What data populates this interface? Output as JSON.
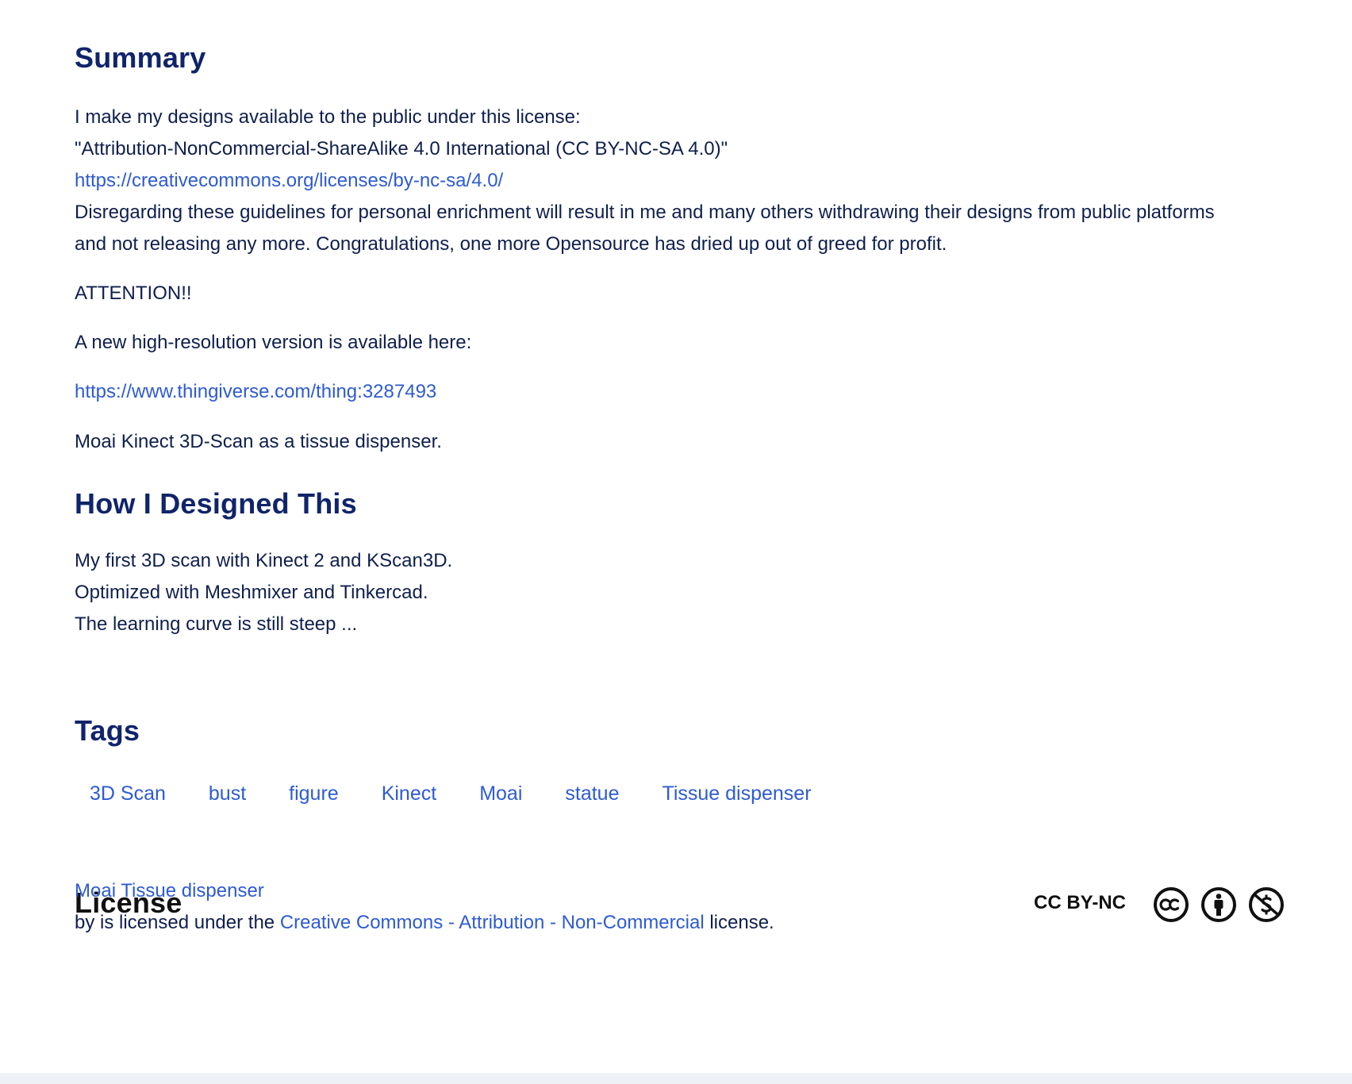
{
  "summary": {
    "title": "Summary",
    "line1": "I make my designs available to the public under this license:",
    "line2": "\"Attribution-NonCommercial-ShareAlike 4.0 International (CC BY-NC-SA 4.0)\"",
    "license_url": "https://creativecommons.org/licenses/by-nc-sa/4.0/",
    "line3": "Disregarding these guidelines for personal enrichment will result in me and many others withdrawing their designs from public platforms",
    "line4": "and not releasing any more. Congratulations, one more Opensource has dried up out of greed for profit.",
    "attention": "ATTENTION!!",
    "new_version": "A new high-resolution version is available here:",
    "thing_url": "https://www.thingiverse.com/thing:3287493",
    "description": "Moai Kinect 3D-Scan as a tissue dispenser."
  },
  "how_designed": {
    "title": "How I Designed This",
    "line1": "My first 3D scan with Kinect 2 and KScan3D.",
    "line2": "Optimized with Meshmixer and Tinkercad.",
    "line3": "The learning curve is still steep ..."
  },
  "tags": {
    "title": "Tags",
    "items": [
      "3D Scan",
      "bust",
      "figure",
      "Kinect",
      "Moai",
      "statue",
      "Tissue dispenser"
    ]
  },
  "license": {
    "title": "License",
    "badge": "CC BY-NC",
    "thing_name": "Moai Tissue dispenser",
    "by_text": "by is licensed under the",
    "license_link": "Creative Commons - Attribution - Non-Commercial",
    "suffix": "license.",
    "icons": [
      "cc-icon",
      "attribution-icon",
      "noncommercial-icon"
    ]
  },
  "colors": {
    "heading": "#10246b",
    "text": "#0f1f4d",
    "link": "#2e5bd3"
  }
}
